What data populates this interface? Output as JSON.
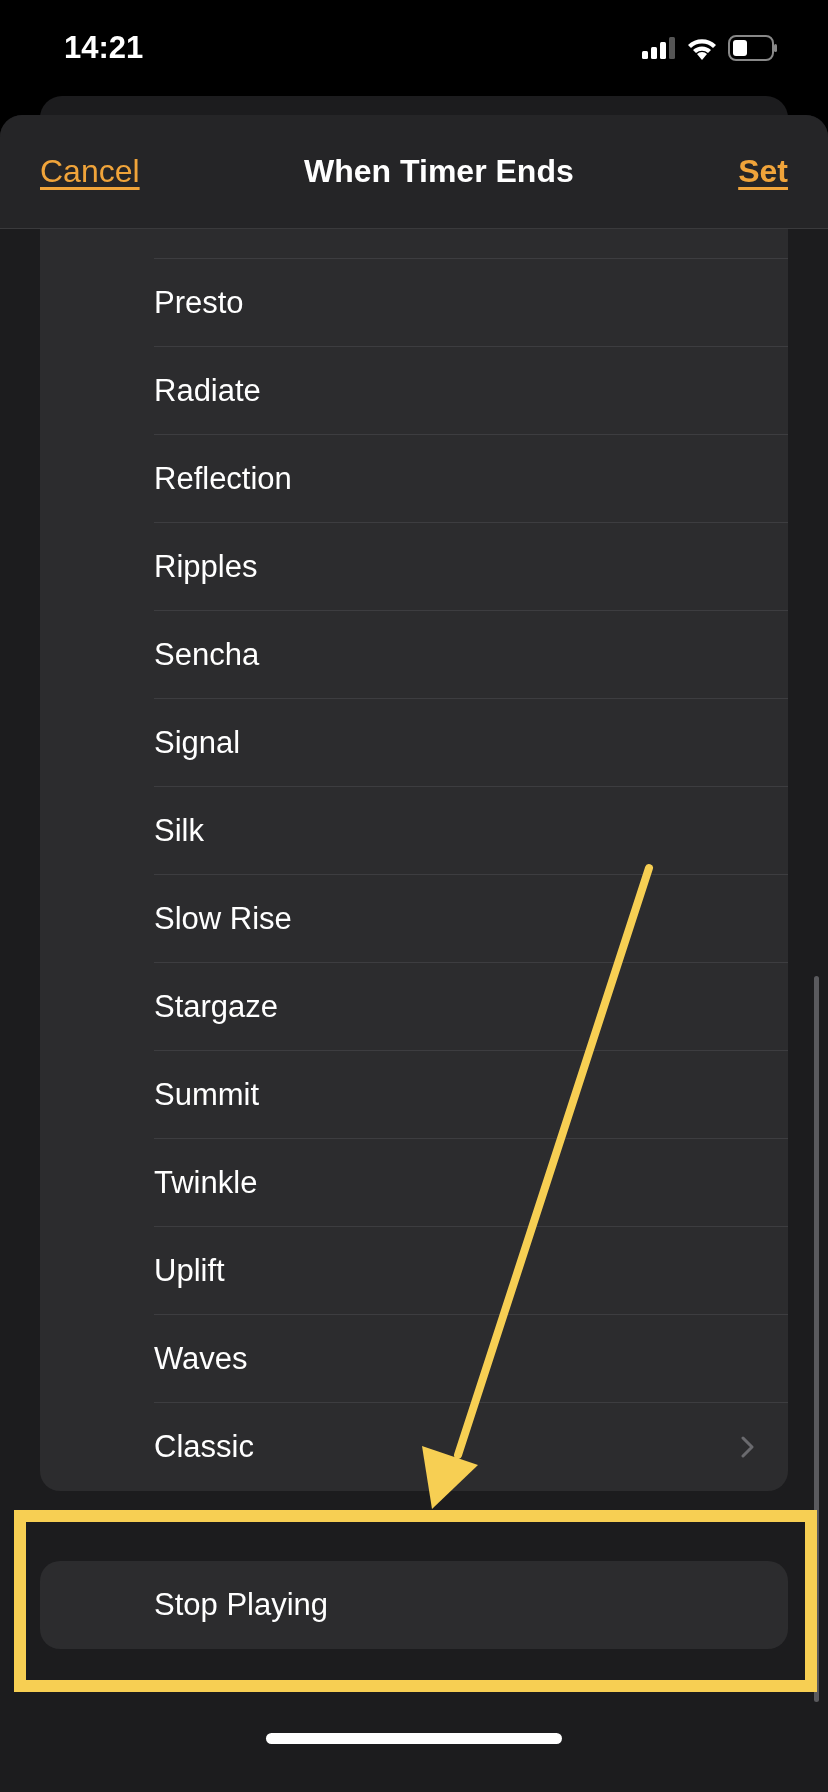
{
  "status_bar": {
    "time": "14:21"
  },
  "header": {
    "cancel": "Cancel",
    "title": "When Timer Ends",
    "set": "Set"
  },
  "sounds": [
    {
      "label": "Presto",
      "kind": "tone"
    },
    {
      "label": "Radiate",
      "kind": "tone"
    },
    {
      "label": "Reflection",
      "kind": "tone"
    },
    {
      "label": "Ripples",
      "kind": "tone"
    },
    {
      "label": "Sencha",
      "kind": "tone"
    },
    {
      "label": "Signal",
      "kind": "tone"
    },
    {
      "label": "Silk",
      "kind": "tone"
    },
    {
      "label": "Slow Rise",
      "kind": "tone"
    },
    {
      "label": "Stargaze",
      "kind": "tone"
    },
    {
      "label": "Summit",
      "kind": "tone"
    },
    {
      "label": "Twinkle",
      "kind": "tone"
    },
    {
      "label": "Uplift",
      "kind": "tone"
    },
    {
      "label": "Waves",
      "kind": "tone"
    },
    {
      "label": "Classic",
      "kind": "more"
    }
  ],
  "stop_option": {
    "label": "Stop Playing"
  }
}
